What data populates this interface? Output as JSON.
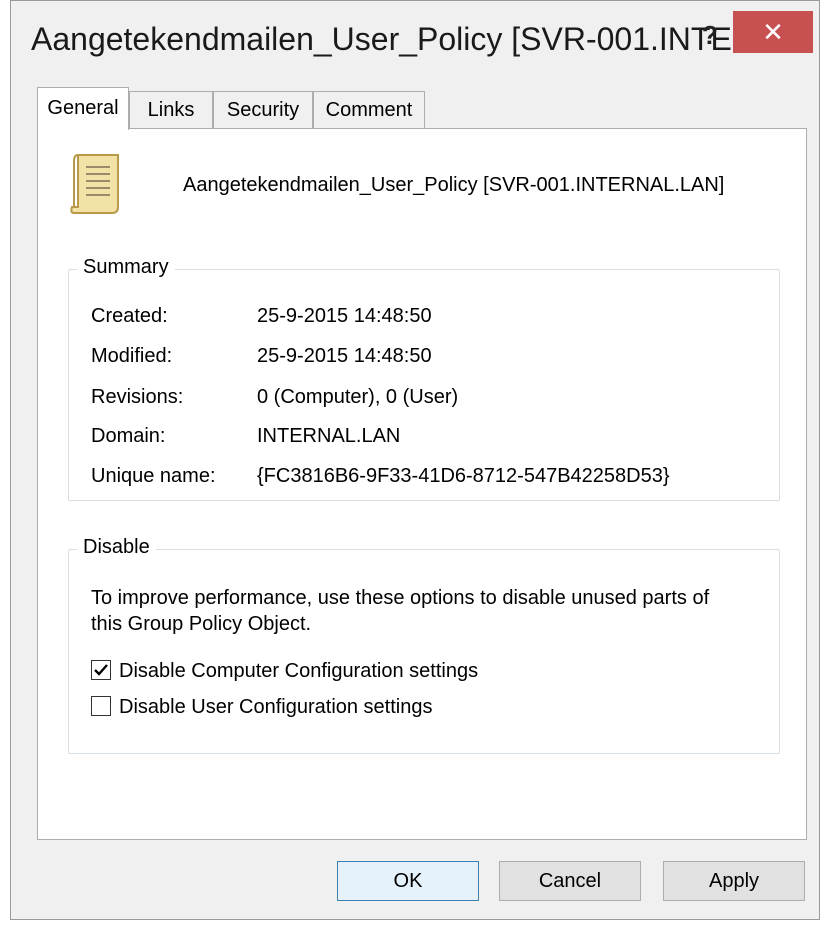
{
  "window": {
    "title": "Aangetekendmailen_User_Policy [SVR-001.INTE...",
    "help_label": "?",
    "close_label": "✕"
  },
  "tabs": [
    {
      "label": "General",
      "active": true
    },
    {
      "label": "Links",
      "active": false
    },
    {
      "label": "Security",
      "active": false
    },
    {
      "label": "Comment",
      "active": false
    }
  ],
  "general": {
    "icon": "document-icon",
    "policy_name": "Aangetekendmailen_User_Policy [SVR-001.INTERNAL.LAN]",
    "summary": {
      "legend": "Summary",
      "rows": [
        {
          "label": "Created:",
          "value": "25-9-2015 14:48:50"
        },
        {
          "label": "Modified:",
          "value": "25-9-2015 14:48:50"
        },
        {
          "label": "Revisions:",
          "value": "0 (Computer), 0 (User)"
        },
        {
          "label": "Domain:",
          "value": "INTERNAL.LAN"
        },
        {
          "label": "Unique name:",
          "value": "{FC3816B6-9F33-41D6-8712-547B42258D53}"
        }
      ]
    },
    "disable": {
      "legend": "Disable",
      "description": "To improve performance, use these options to disable unused parts of this Group Policy Object.",
      "options": [
        {
          "label": "Disable Computer Configuration settings",
          "checked": true
        },
        {
          "label": "Disable User Configuration settings",
          "checked": false
        }
      ]
    }
  },
  "buttons": {
    "ok": "OK",
    "cancel": "Cancel",
    "apply": "Apply"
  }
}
